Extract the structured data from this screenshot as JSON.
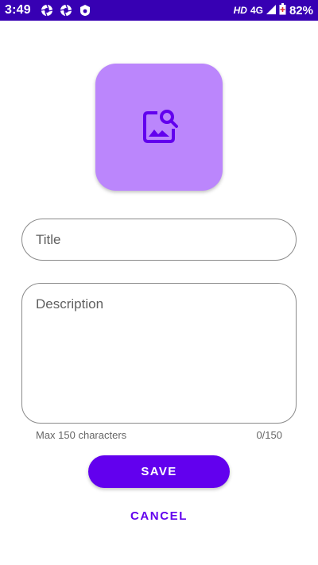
{
  "status_bar": {
    "time": "3:49",
    "network_hd": "HD",
    "network_type": "4G",
    "battery": "82%",
    "icons": [
      "aperture-icon",
      "aperture-icon",
      "shield-icon",
      "signal-icon",
      "battery-icon"
    ]
  },
  "colors": {
    "status_bar": "#3700b3",
    "primary": "#6200ee",
    "image_tile": "#bb86fc"
  },
  "image_picker": {
    "icon": "image-search-icon"
  },
  "form": {
    "title_placeholder": "Title",
    "description_placeholder": "Description",
    "helper_text": "Max 150 characters",
    "char_counter": "0/150"
  },
  "actions": {
    "save_label": "SAVE",
    "cancel_label": "CANCEL"
  }
}
